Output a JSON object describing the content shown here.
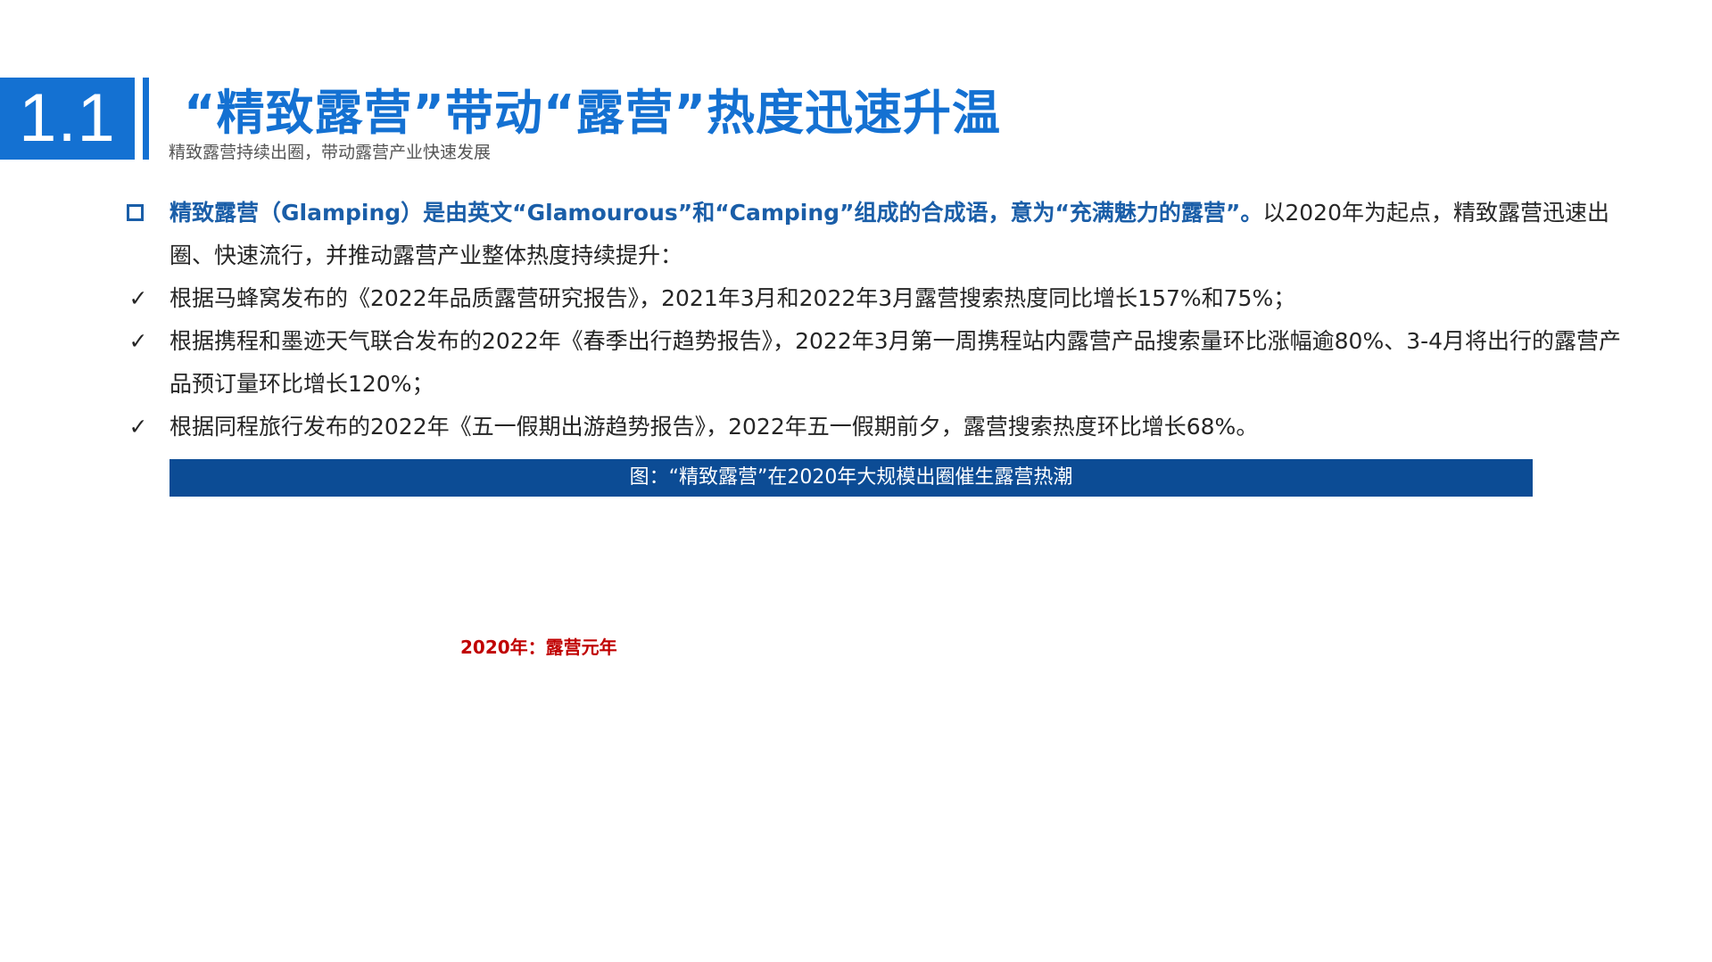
{
  "header": {
    "section_number": "1.1",
    "title": "“精致露营”带动“露营”热度迅速升温",
    "subtitle": "精致露营持续出圈，带动露营产业快速发展"
  },
  "intro": {
    "highlight": "精致露营（Glamping）是由英文“Glamourous”和“Camping”组成的合成语，意为“充满魅力的露营”。",
    "rest": "以2020年为起点，精致露营迅速出圈、快速流行，并推动露营产业整体热度持续提升："
  },
  "checks": [
    {
      "marker": "✓",
      "text": "根据马蜂窝发布的《2022年品质露营研究报告》，2021年3月和2022年3月露营搜索热度同比增长157%和75%；"
    },
    {
      "marker": "✓",
      "text": "根据携程和墨迹天气联合发布的2022年《春季出行趋势报告》，2022年3月第一周携程站内露营产品搜索量环比涨幅逾80%、3-4月将出行的露营产品预订量环比增长120%；"
    },
    {
      "marker": "✓",
      "text": "根据同程旅行发布的2022年《五一假期出游趋势报告》，2022年五一假期前夕，露营搜索热度环比增长68%。"
    }
  ],
  "figure": {
    "caption": "图：“精致露营”在2020年大规模出圈催生露营热潮",
    "label": "2020年：露营元年"
  },
  "colors": {
    "accent_blue": "#1471d2",
    "caption_bar": "#0c4c95",
    "highlight_text": "#1a5ea8",
    "label_red": "#c00000"
  }
}
